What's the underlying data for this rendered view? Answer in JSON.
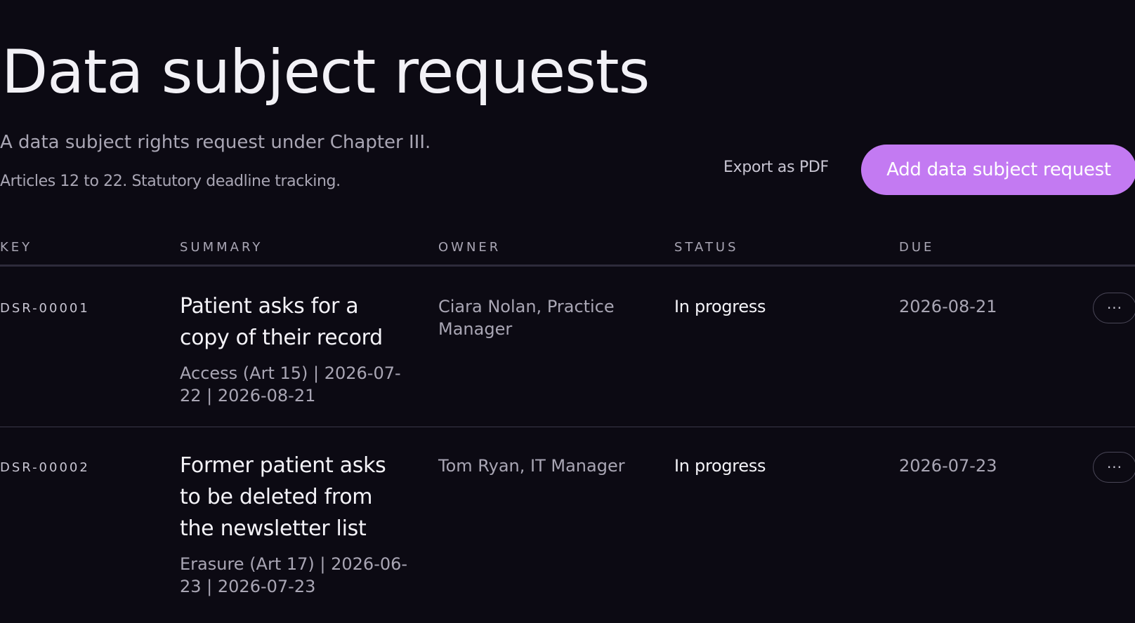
{
  "header": {
    "title": "Data subject requests",
    "subtitle": "A data subject rights request under Chapter III.",
    "description": "Articles 12 to 22. Statutory deadline tracking.",
    "export_label": "Export as PDF",
    "add_label": "Add data subject request"
  },
  "table": {
    "columns": {
      "key": "KEY",
      "summary": "SUMMARY",
      "owner": "OWNER",
      "status": "STATUS",
      "due": "DUE"
    },
    "rows": [
      {
        "key": "DSR-00001",
        "title": "Patient asks for a copy of their record",
        "meta": "Access (Art 15) | 2026-07-22 | 2026-08-21",
        "owner": "Ciara Nolan, Practice Manager",
        "status": "In progress",
        "due": "2026-08-21",
        "menu_icon": "ellipsis-icon"
      },
      {
        "key": "DSR-00002",
        "title": "Former patient asks to be deleted from the newsletter list",
        "meta": "Erasure (Art 17) | 2026-06-23 | 2026-07-23",
        "owner": "Tom Ryan, IT Manager",
        "status": "In progress",
        "due": "2026-07-23",
        "menu_icon": "ellipsis-icon"
      }
    ]
  },
  "colors": {
    "background": "#0c0a13",
    "accent": "#c37af2",
    "text_primary": "#f4f3f8",
    "text_muted": "#a9a6b4"
  }
}
